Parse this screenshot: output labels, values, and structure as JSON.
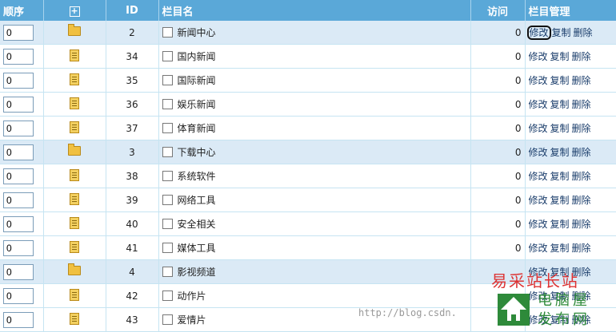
{
  "header": {
    "order": "顺序",
    "expand": "+",
    "id": "ID",
    "name": "栏目名",
    "visits": "访问",
    "manage": "栏目管理"
  },
  "actions": {
    "edit": "修改",
    "copy": "复制",
    "delete": "删除"
  },
  "rows": [
    {
      "type": "folder",
      "order": "0",
      "id": "2",
      "name": "新闻中心",
      "visits": "0"
    },
    {
      "type": "doc",
      "order": "0",
      "id": "34",
      "name": "国内新闻",
      "visits": "0"
    },
    {
      "type": "doc",
      "order": "0",
      "id": "35",
      "name": "国际新闻",
      "visits": "0"
    },
    {
      "type": "doc",
      "order": "0",
      "id": "36",
      "name": "娱乐新闻",
      "visits": "0"
    },
    {
      "type": "doc",
      "order": "0",
      "id": "37",
      "name": "体育新闻",
      "visits": "0"
    },
    {
      "type": "folder",
      "order": "0",
      "id": "3",
      "name": "下载中心",
      "visits": "0"
    },
    {
      "type": "doc",
      "order": "0",
      "id": "38",
      "name": "系统软件",
      "visits": "0"
    },
    {
      "type": "doc",
      "order": "0",
      "id": "39",
      "name": "网络工具",
      "visits": "0"
    },
    {
      "type": "doc",
      "order": "0",
      "id": "40",
      "name": "安全相关",
      "visits": "0"
    },
    {
      "type": "doc",
      "order": "0",
      "id": "41",
      "name": "媒体工具",
      "visits": "0"
    },
    {
      "type": "folder",
      "order": "0",
      "id": "4",
      "name": "影视频道",
      "visits": ""
    },
    {
      "type": "doc",
      "order": "0",
      "id": "42",
      "name": "动作片",
      "visits": ""
    },
    {
      "type": "doc",
      "order": "0",
      "id": "43",
      "name": "爱情片",
      "visits": ""
    }
  ],
  "watermark": {
    "url": "http://blog.csdn.",
    "site1": "易采站长站",
    "site2": "电脑屋",
    "site3": "发布网"
  }
}
